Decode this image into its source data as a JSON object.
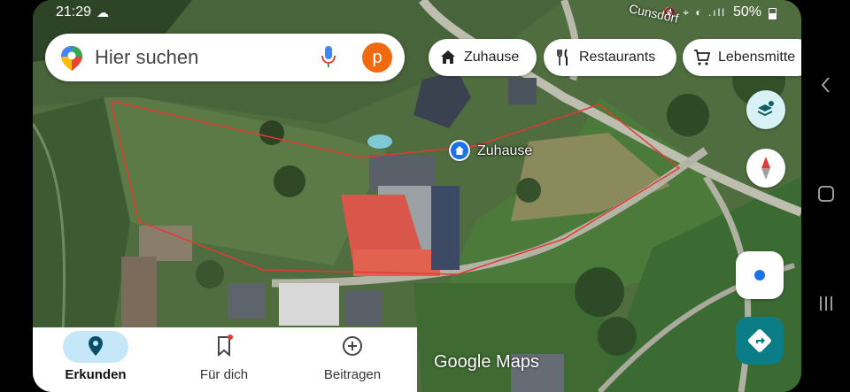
{
  "status_bar": {
    "time": "21:29",
    "cloud_glyph": "☁",
    "icons": "🔇 ⌖ ◐ .ıll",
    "battery": "50%"
  },
  "search": {
    "placeholder": "Hier suchen",
    "avatar_letter": "p"
  },
  "chips": [
    {
      "label": "Zuhause",
      "icon": "home-icon"
    },
    {
      "label": "Restaurants",
      "icon": "fork-knife-icon"
    },
    {
      "label": "Lebensmitte",
      "icon": "cart-icon"
    }
  ],
  "map": {
    "place_label": "Zuhause",
    "town_label": "Cunsdorf",
    "watermark": "Google Maps",
    "boundary_color": "#e53935"
  },
  "bottom_nav": [
    {
      "label": "Erkunden",
      "icon": "pin-icon",
      "active": true
    },
    {
      "label": "Für dich",
      "icon": "bookmark-icon",
      "active": false
    },
    {
      "label": "Beitragen",
      "icon": "plus-circle-icon",
      "active": false
    }
  ],
  "colors": {
    "accent": "#1a73e8",
    "avatar": "#f26a0f",
    "directions": "#0b7d86"
  }
}
